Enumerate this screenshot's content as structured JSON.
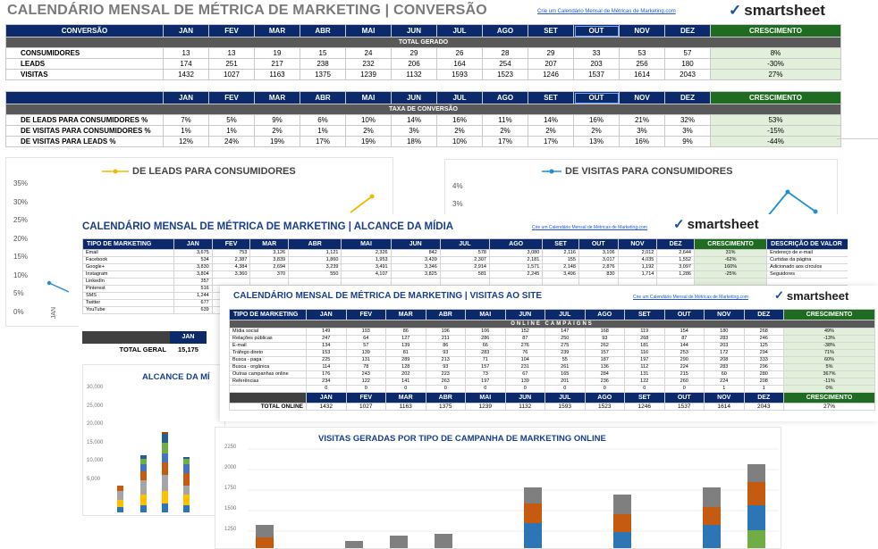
{
  "sheet1": {
    "title": "CALENDÁRIO MENSAL DE MÉTRICA DE MARKETING | CONVERSÃO",
    "link": "Crie um Calendário Mensal de Métricas de Marketing.com",
    "logo": "smartsheet",
    "months": [
      "JAN",
      "FEV",
      "MAR",
      "ABR",
      "MAI",
      "JUN",
      "JUL",
      "AGO",
      "SET",
      "OUT",
      "NOV",
      "DEZ"
    ],
    "growth_label": "CRESCIMENTO",
    "table1": {
      "corner": "CONVERSÃO",
      "section": "TOTAL GERADO",
      "rows": [
        {
          "label": "CONSUMIDORES",
          "values": [
            "13",
            "13",
            "19",
            "15",
            "24",
            "29",
            "26",
            "28",
            "29",
            "33",
            "53",
            "57"
          ],
          "growth": "8%"
        },
        {
          "label": "LEADS",
          "values": [
            "174",
            "251",
            "217",
            "238",
            "232",
            "206",
            "164",
            "254",
            "207",
            "203",
            "256",
            "180"
          ],
          "growth": "-30%"
        },
        {
          "label": "VISITAS",
          "values": [
            "1432",
            "1027",
            "1163",
            "1375",
            "1239",
            "1132",
            "1593",
            "1523",
            "1246",
            "1537",
            "1614",
            "2043"
          ],
          "growth": "27%"
        }
      ]
    },
    "table2": {
      "section": "TAXA DE CONVERSÃO",
      "rows": [
        {
          "label": "DE LEADS PARA CONSUMIDORES %",
          "values": [
            "7%",
            "5%",
            "9%",
            "6%",
            "10%",
            "14%",
            "16%",
            "11%",
            "14%",
            "16%",
            "21%",
            "32%"
          ],
          "growth": "53%"
        },
        {
          "label": "DE VISITAS PARA CONSUMIDORES %",
          "values": [
            "1%",
            "1%",
            "2%",
            "1%",
            "2%",
            "3%",
            "2%",
            "2%",
            "2%",
            "2%",
            "3%",
            "3%"
          ],
          "growth": "-15%"
        },
        {
          "label": "DE VISITAS PARA LEADS %",
          "values": [
            "12%",
            "24%",
            "19%",
            "17%",
            "19%",
            "18%",
            "10%",
            "17%",
            "17%",
            "13%",
            "16%",
            "9%"
          ],
          "growth": "-44%"
        }
      ]
    }
  },
  "chart_leads": {
    "title": "DE LEADS PARA CONSUMIDORES",
    "yticks": [
      "35%",
      "30%",
      "25%",
      "20%",
      "15%",
      "10%",
      "5%",
      "0%"
    ],
    "x_visible": "JAN"
  },
  "chart_visitas": {
    "title": "DE VISITAS PARA CONSUMIDORES",
    "yticks": [
      "4%",
      "3%"
    ]
  },
  "sheet2": {
    "title": "CALENDÁRIO MENSAL DE MÉTRICA DE MARKETING   |   ALCANCE DA MÍDIA",
    "link": "Crie um Calendário Mensal de Métricas de Marketing.com",
    "logo": "smartsheet",
    "corner": "TIPO DE MARKETING",
    "desc_label": "DESCRIÇÃO DE VALOR",
    "rows": [
      {
        "label": "Email",
        "values": [
          "3,675",
          "753",
          "3,126",
          "1,121",
          "2,326",
          "842",
          "578",
          "3,080",
          "2,116",
          "3,106",
          "2,012",
          "2,644"
        ],
        "growth": "31%",
        "desc": "Endereço de e-mail"
      },
      {
        "label": "Facebook",
        "values": [
          "534",
          "2,387",
          "3,839",
          "1,860",
          "1,953",
          "3,439",
          "2,307",
          "2,181",
          "155",
          "3,017",
          "4,035",
          "1,552"
        ],
        "growth": "-62%",
        "desc": "Curtidas da página"
      },
      {
        "label": "Google+",
        "values": [
          "3,830",
          "4,384",
          "2,694",
          "3,239",
          "3,491",
          "3,346",
          "2,914",
          "1,571",
          "2,148",
          "2,876",
          "1,192",
          "3,097"
        ],
        "growth": "160%",
        "desc": "Adicionado aos círculos"
      },
      {
        "label": "Instagram",
        "values": [
          "3,804",
          "3,360",
          "370",
          "550",
          "4,107",
          "3,825",
          "581",
          "2,245",
          "3,496",
          "830",
          "1,714",
          "1,286"
        ],
        "growth": "-25%",
        "desc": "Seguidores"
      },
      {
        "label": "LinkedIn",
        "values": [
          "357"
        ],
        "growth": "",
        "desc": ""
      },
      {
        "label": "Pinterest",
        "values": [
          "516"
        ],
        "growth": "",
        "desc": ""
      },
      {
        "label": "SMS",
        "values": [
          "1,244"
        ],
        "growth": "",
        "desc": ""
      },
      {
        "label": "Twitter",
        "values": [
          "677"
        ],
        "growth": "",
        "desc": ""
      },
      {
        "label": "YouTube",
        "values": [
          "639"
        ],
        "growth": "",
        "desc": ""
      }
    ],
    "total_label": "TOTAL GERAL",
    "total_value": "15,175",
    "foot_month": "JAN"
  },
  "chart_alcance": {
    "title": "ALCANCE DA MÍ",
    "yticks": [
      "30,000",
      "25,000",
      "20,000",
      "15,000",
      "10,000",
      "5,000"
    ]
  },
  "sheet3": {
    "title": "CALENDÁRIO MENSAL DE MÉTRICA DE MARKETING   |   VISITAS AO SITE",
    "link": "Crie um Calendário Mensal de Métricas de Marketing.com",
    "logo": "smartsheet",
    "corner": "TIPO DE MARKETING",
    "section": "ONLINE CAMPAIGNS",
    "rows": [
      {
        "label": "Mídia social",
        "values": [
          "149",
          "193",
          "86",
          "196",
          "106",
          "152",
          "147",
          "168",
          "119",
          "154",
          "180",
          "268"
        ],
        "growth": "49%"
      },
      {
        "label": "Relações públicas",
        "values": [
          "247",
          "64",
          "127",
          "211",
          "286",
          "87",
          "250",
          "93",
          "268",
          "87",
          "283",
          "246"
        ],
        "growth": "-13%"
      },
      {
        "label": "E-mail",
        "values": [
          "134",
          "57",
          "139",
          "86",
          "66",
          "276",
          "275",
          "262",
          "181",
          "144",
          "203",
          "125"
        ],
        "growth": "-38%"
      },
      {
        "label": "Tráfego direto",
        "values": [
          "153",
          "139",
          "81",
          "93",
          "283",
          "76",
          "239",
          "157",
          "116",
          "253",
          "172",
          "294"
        ],
        "growth": "71%"
      },
      {
        "label": "Busca - paga",
        "values": [
          "225",
          "131",
          "289",
          "213",
          "71",
          "104",
          "55",
          "187",
          "197",
          "290",
          "208",
          "333"
        ],
        "growth": "60%"
      },
      {
        "label": "Busca - orgânica",
        "values": [
          "114",
          "78",
          "128",
          "93",
          "157",
          "231",
          "261",
          "136",
          "112",
          "224",
          "283",
          "296"
        ],
        "growth": "5%"
      },
      {
        "label": "Outras campanhas online",
        "values": [
          "176",
          "243",
          "202",
          "223",
          "73",
          "67",
          "165",
          "284",
          "131",
          "215",
          "60",
          "280"
        ],
        "growth": "367%"
      },
      {
        "label": "Referências",
        "values": [
          "234",
          "122",
          "141",
          "263",
          "197",
          "139",
          "201",
          "236",
          "122",
          "260",
          "224",
          "208"
        ],
        "growth": "-11%"
      },
      {
        "label": "",
        "values": [
          "0",
          "0",
          "0",
          "0",
          "0",
          "0",
          "0",
          "0",
          "0",
          "0",
          "1",
          "1"
        ],
        "growth": "0%"
      }
    ],
    "total_label": "TOTAL ONLINE",
    "totals": [
      "1432",
      "1027",
      "1163",
      "1375",
      "1239",
      "1132",
      "1593",
      "1523",
      "1246",
      "1537",
      "1614",
      "2043"
    ],
    "total_growth": "27%"
  },
  "chart_visitas_campanha": {
    "title": "VISITAS GERADAS POR TIPO DE CAMPANHA DE MARKETING ONLINE",
    "yticks": [
      "2250",
      "2000",
      "1750",
      "1500",
      "1250"
    ]
  },
  "colors": {
    "header_navy": "#0c2a6b",
    "growth_green": "#1e6b21",
    "section_gray": "#595959",
    "growth_cell": "#e2efda",
    "line_yellow": "#f5b800",
    "line_blue": "#1f8fd6",
    "sheet2_header_blue": "#1a3e8e"
  }
}
